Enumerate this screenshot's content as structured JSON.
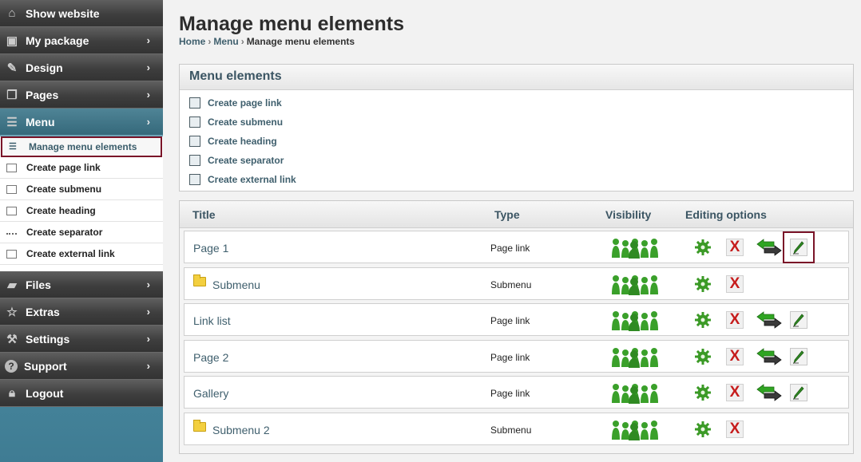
{
  "sidebar": {
    "top_items": [
      {
        "label": "Show website",
        "icon": "house-icon",
        "chevron": ""
      },
      {
        "label": "My package",
        "icon": "package-icon",
        "chevron": "›"
      },
      {
        "label": "Design",
        "icon": "brush-icon",
        "chevron": "›"
      },
      {
        "label": "Pages",
        "icon": "pages-icon",
        "chevron": "›"
      },
      {
        "label": "Menu",
        "icon": "list-icon",
        "chevron": "›"
      }
    ],
    "sub_items": [
      {
        "label": "Manage menu elements",
        "icon": "list-icon"
      },
      {
        "label": "Create page link",
        "icon": "page-link-icon"
      },
      {
        "label": "Create submenu",
        "icon": "submenu-icon"
      },
      {
        "label": "Create heading",
        "icon": "heading-icon"
      },
      {
        "label": "Create separator",
        "icon": "separator-icon"
      },
      {
        "label": "Create external link",
        "icon": "external-link-icon"
      }
    ],
    "bottom_items": [
      {
        "label": "Files",
        "icon": "folder-icon",
        "chevron": "›"
      },
      {
        "label": "Extras",
        "icon": "star-icon",
        "chevron": "›"
      },
      {
        "label": "Settings",
        "icon": "wrench-icon",
        "chevron": "›"
      },
      {
        "label": "Support",
        "icon": "help-icon",
        "chevron": "›"
      },
      {
        "label": "Logout",
        "icon": "lock-icon",
        "chevron": ""
      }
    ]
  },
  "page": {
    "title": "Manage menu elements",
    "breadcrumb": [
      "Home",
      "Menu",
      "Manage menu elements"
    ]
  },
  "menu_elements": {
    "heading": "Menu elements",
    "actions": [
      {
        "label": "Create page link",
        "icon": "page-link-icon"
      },
      {
        "label": "Create submenu",
        "icon": "submenu-icon"
      },
      {
        "label": "Create heading",
        "icon": "heading-icon"
      },
      {
        "label": "Create separator",
        "icon": "separator-icon"
      },
      {
        "label": "Create external link",
        "icon": "external-link-icon"
      }
    ]
  },
  "table": {
    "columns": {
      "title": "Title",
      "type": "Type",
      "visibility": "Visibility",
      "options": "Editing options"
    },
    "rows": [
      {
        "title": "Page 1",
        "type": "Page link",
        "folder": false,
        "movable": true,
        "editable": true
      },
      {
        "title": "Submenu",
        "type": "Submenu",
        "folder": true,
        "movable": false,
        "editable": false
      },
      {
        "title": "Link list",
        "type": "Page link",
        "folder": false,
        "movable": true,
        "editable": true
      },
      {
        "title": "Page 2",
        "type": "Page link",
        "folder": false,
        "movable": true,
        "editable": true
      },
      {
        "title": "Gallery",
        "type": "Page link",
        "folder": false,
        "movable": true,
        "editable": true
      },
      {
        "title": "Submenu 2",
        "type": "Submenu",
        "folder": true,
        "movable": false,
        "editable": false
      }
    ]
  },
  "colors": {
    "accent": "#3f5f6d",
    "highlight": "#7a1428",
    "visibility": "#3aa02a",
    "delete": "#c61c1c"
  }
}
